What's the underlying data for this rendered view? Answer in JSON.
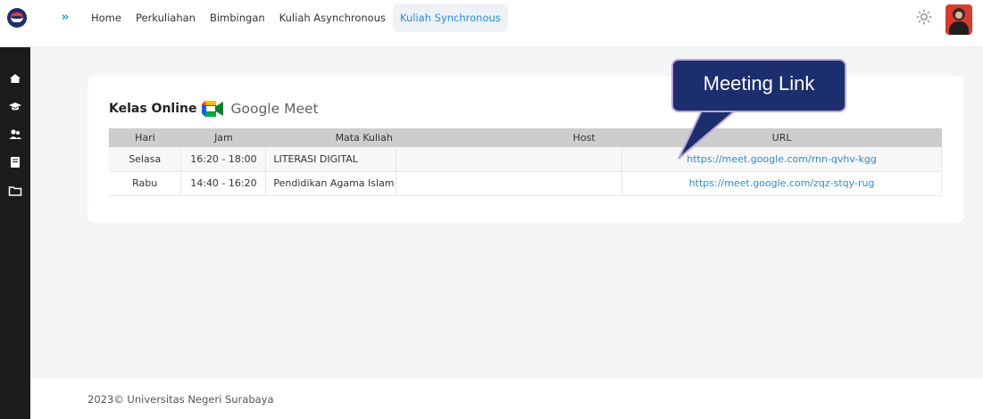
{
  "header": {
    "logo_icon": "unesa-logo",
    "expand_icon": "double-chevron-right-icon",
    "nav": [
      {
        "label": "Home"
      },
      {
        "label": "Perkuliahan"
      },
      {
        "label": "Bimbingan"
      },
      {
        "label": "Kuliah Asynchronous"
      },
      {
        "label": "Kuliah Synchronous",
        "active": true
      }
    ],
    "theme_icon": "sun-icon",
    "avatar": "user-avatar"
  },
  "sidebar": {
    "icons": [
      "home-icon",
      "graduation-cap-icon",
      "users-icon",
      "book-icon",
      "folder-icon"
    ]
  },
  "card": {
    "title": "Kelas Online",
    "meet_brand": "Google Meet",
    "columns": [
      "Hari",
      "Jam",
      "Mata Kuliah",
      "Host",
      "URL"
    ],
    "rows": [
      {
        "hari": "Selasa",
        "jam": "16:20 - 18:00",
        "mata_kuliah": "LITERASI DIGITAL",
        "host": "",
        "url": "https://meet.google.com/rnn-qvhv-kgg"
      },
      {
        "hari": "Rabu",
        "jam": "14:40 - 16:20",
        "mata_kuliah": "Pendidikan Agama Islam",
        "host": "",
        "url": "https://meet.google.com/zqz-stqy-rug"
      }
    ]
  },
  "callout": {
    "text": "Meeting Link"
  },
  "footer": {
    "text": "2023© Universitas Negeri Surabaya"
  },
  "colors": {
    "accent": "#2b8bd6",
    "sidebar_bg": "#1c1c1f",
    "callout_bg": "#1c2e6d"
  }
}
